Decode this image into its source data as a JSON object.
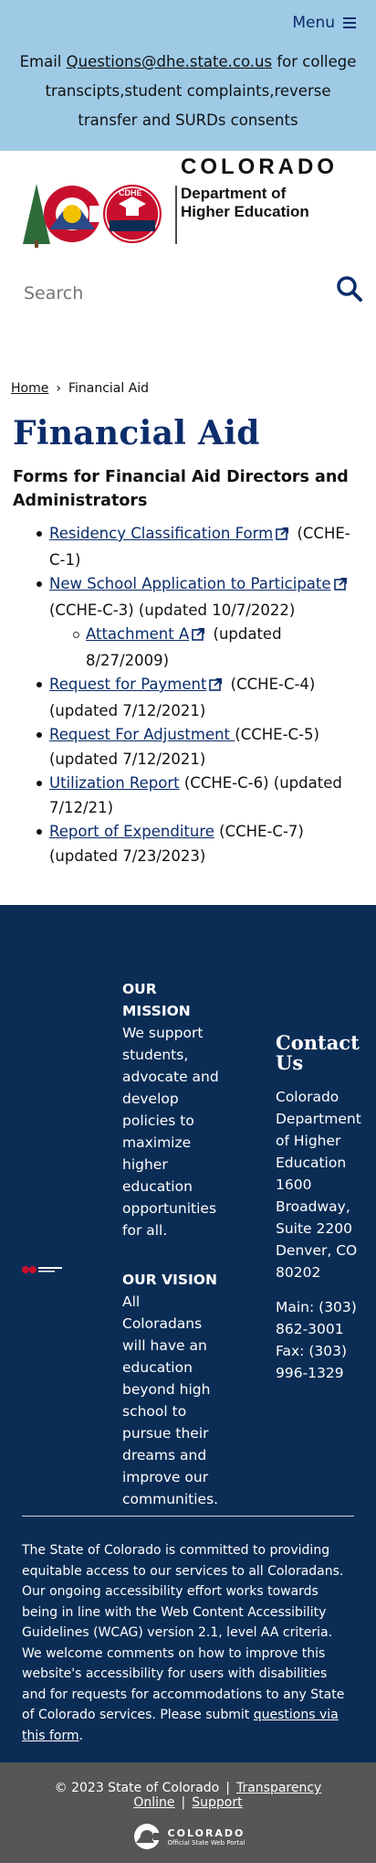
{
  "banner": {
    "menu_label": "Menu",
    "message_prefix": "Email ",
    "message_email": "Questions@dhe.state.co.us",
    "message_suffix": " for college transcipts,student complaints,reverse transfer and SURDs consents"
  },
  "logo": {
    "wordmark": "COLORADO",
    "dept_line1": "Department of",
    "dept_line2": "Higher Education",
    "badge": "CDHE"
  },
  "search": {
    "placeholder": "Search"
  },
  "breadcrumb": {
    "home": "Home",
    "separator": "›",
    "current": "Financial Aid"
  },
  "page": {
    "title": "Financial Aid",
    "subtitle": "Forms for Financial Aid Directors and Administrators"
  },
  "forms": [
    {
      "link": "Residency Classification Form",
      "external": true,
      "note": " (CCHE-C-1)"
    },
    {
      "link": "New School Application to Participate",
      "external": true,
      "note": " (CCHE-C-3) (updated 10/7/2022)",
      "sub": {
        "link": "Attachment A",
        "external": true,
        "note": " (updated 8/27/2009)"
      }
    },
    {
      "link": "Request for Payment",
      "external": true,
      "note": " (CCHE-C-4) (updated 7/12/2021)"
    },
    {
      "link": "Request For Adjustment ",
      "external": false,
      "note": "(CCHE-C-5) (updated 7/12/2021)"
    },
    {
      "link": "Utilization Report",
      "external": false,
      "note": " (CCHE-C-6) (updated 7/12/21)"
    },
    {
      "link": "Report of Expenditure",
      "external": false,
      "note": " (CCHE-C-7) (updated 7/23/2023)"
    }
  ],
  "footer": {
    "mission_title": "OUR MISSION",
    "mission_text": "We support students, advocate and develop policies to maximize higher education opportunities for all.",
    "vision_title": "OUR VISION",
    "vision_text": "All Coloradans will have an education beyond high school to pursue their dreams and improve our communities.",
    "contact_title": "Contact Us",
    "address": "Colorado Department of Higher Education 1600 Broadway, Suite 2200 Denver, CO 80202",
    "phone": "Main: (303) 862-3001",
    "fax": "Fax: (303) 996-1329",
    "accessibility_text": "The State of Colorado is committed to providing equitable access to our services to all Coloradans. Our ongoing accessibility effort works towards being in line with the Web Content Accessibility Guidelines (WCAG) version 2.1, level AA criteria. We welcome comments on how to improve this website's accessibility for users with disabilities and for requests for accommodations to any State of Colorado services. Please submit ",
    "accessibility_link": "questions via this form",
    "accessibility_end": "."
  },
  "bottom": {
    "copyright": "© 2023 State of Colorado",
    "sep": "|",
    "transparency": "Transparency Online",
    "support": "Support",
    "portal_name": "COLORADO",
    "portal_sub": "Official State Web Portal"
  },
  "colors": {
    "banner": "#9ecae6",
    "navy": "#0b2d55",
    "link": "#0b2d6b",
    "bottom_bar": "#565656"
  }
}
